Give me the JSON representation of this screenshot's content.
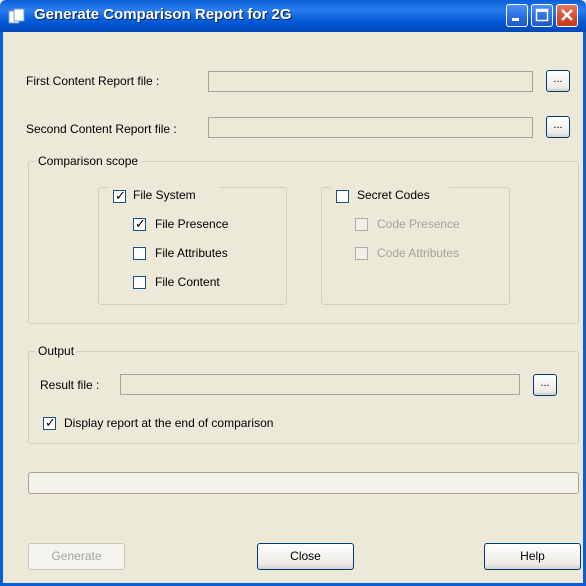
{
  "window": {
    "title": "Generate Comparison Report for 2G",
    "controls": {
      "minimize_icon": "minimize-icon",
      "maximize_icon": "maximize-icon",
      "close_icon": "close-icon"
    },
    "colors": {
      "titlebar": "#0a5fd8",
      "face": "#ece9d8"
    }
  },
  "inputs": {
    "first_label": "First Content Report file :",
    "first_value": "",
    "second_label": "Second Content Report file :",
    "second_value": "",
    "browse_label": "..."
  },
  "scope": {
    "legend": "Comparison scope",
    "file_system": {
      "label": "File System",
      "checked": true,
      "items": [
        {
          "label": "File Presence",
          "checked": true
        },
        {
          "label": "File Attributes",
          "checked": false
        },
        {
          "label": "File Content",
          "checked": false
        }
      ]
    },
    "secret_codes": {
      "label": "Secret Codes",
      "checked": false,
      "items": [
        {
          "label": "Code Presence",
          "checked": false,
          "enabled": false
        },
        {
          "label": "Code Attributes",
          "checked": false,
          "enabled": false
        }
      ]
    }
  },
  "output": {
    "legend": "Output",
    "result_label": "Result file :",
    "result_value": "",
    "browse_label": "...",
    "display_report_label": "Display report at the end of comparison",
    "display_report_checked": true
  },
  "progress": {
    "value": 0
  },
  "buttons": {
    "generate": "Generate",
    "close": "Close",
    "help": "Help"
  }
}
